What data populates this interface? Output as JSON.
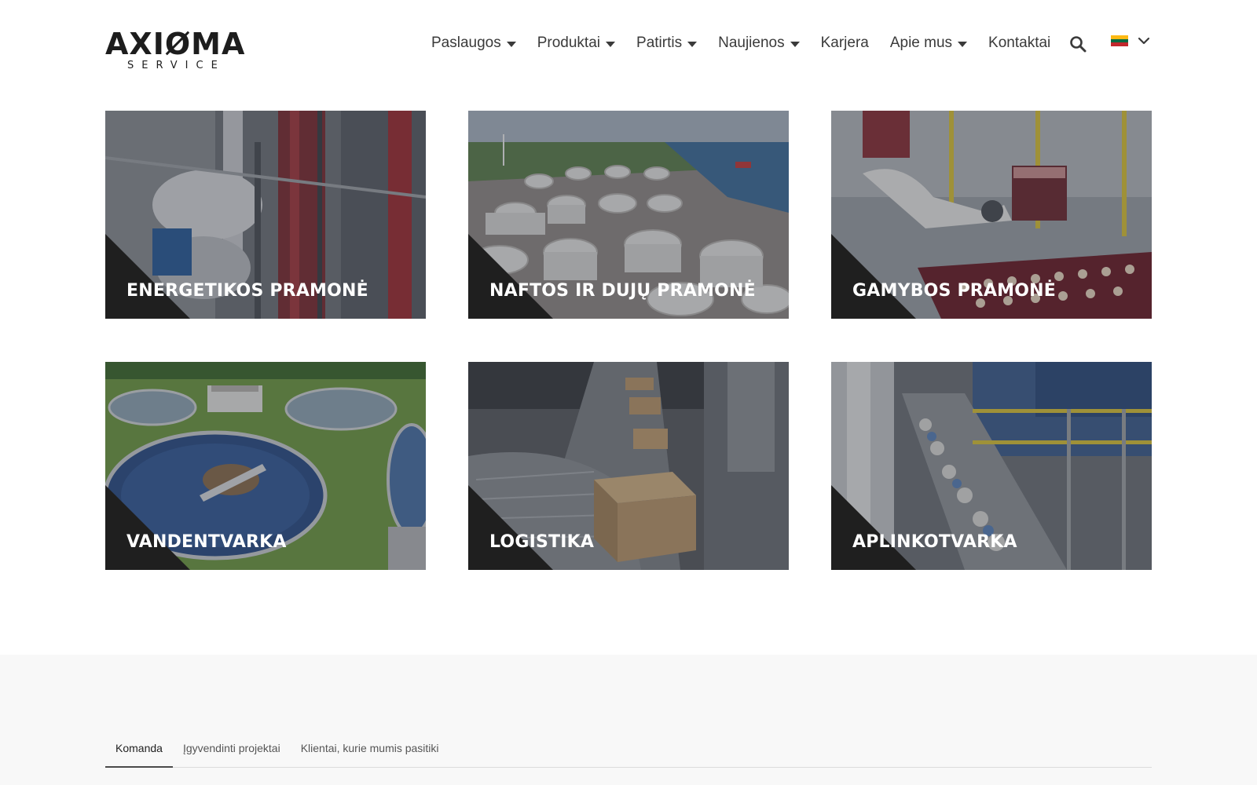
{
  "brand": {
    "name": "AXIØMA",
    "sub": "SERVICE"
  },
  "nav": {
    "items": [
      {
        "label": "Paslaugos",
        "dropdown": true
      },
      {
        "label": "Produktai",
        "dropdown": true
      },
      {
        "label": "Patirtis",
        "dropdown": true
      },
      {
        "label": "Naujienos",
        "dropdown": true
      },
      {
        "label": "Karjera",
        "dropdown": false
      },
      {
        "label": "Apie mus",
        "dropdown": true
      },
      {
        "label": "Kontaktai",
        "dropdown": false
      }
    ],
    "search_icon": "search-icon",
    "language_flag": "lithuania-flag-icon",
    "language_chevron": "chevron-down-icon"
  },
  "industries": [
    {
      "label": "ENERGETIKOS PRAMONĖ",
      "image": "industrial-piping-photo"
    },
    {
      "label": "NAFTOS IR DUJŲ PRAMONĖ",
      "image": "oil-storage-tanks-photo"
    },
    {
      "label": "GAMYBOS PRAMONĖ",
      "image": "robot-arm-factory-photo"
    },
    {
      "label": "VANDENTVARKA",
      "image": "water-treatment-plant-photo"
    },
    {
      "label": "LOGISTIKA",
      "image": "conveyor-boxes-photo"
    },
    {
      "label": "APLINKOTVARKA",
      "image": "waste-sorting-plant-photo"
    }
  ],
  "tabs": [
    {
      "label": "Komanda",
      "active": true
    },
    {
      "label": "Įgyvendinti projektai",
      "active": false
    },
    {
      "label": "Klientai, kurie mumis pasitiki",
      "active": false
    }
  ],
  "colors": {
    "text": "#3a3a3a",
    "card_corner": "#1f1f1f",
    "section_bg": "#f8f8f8",
    "flag_yellow": "#FDB913",
    "flag_green": "#006A44",
    "flag_red": "#C1272D"
  }
}
